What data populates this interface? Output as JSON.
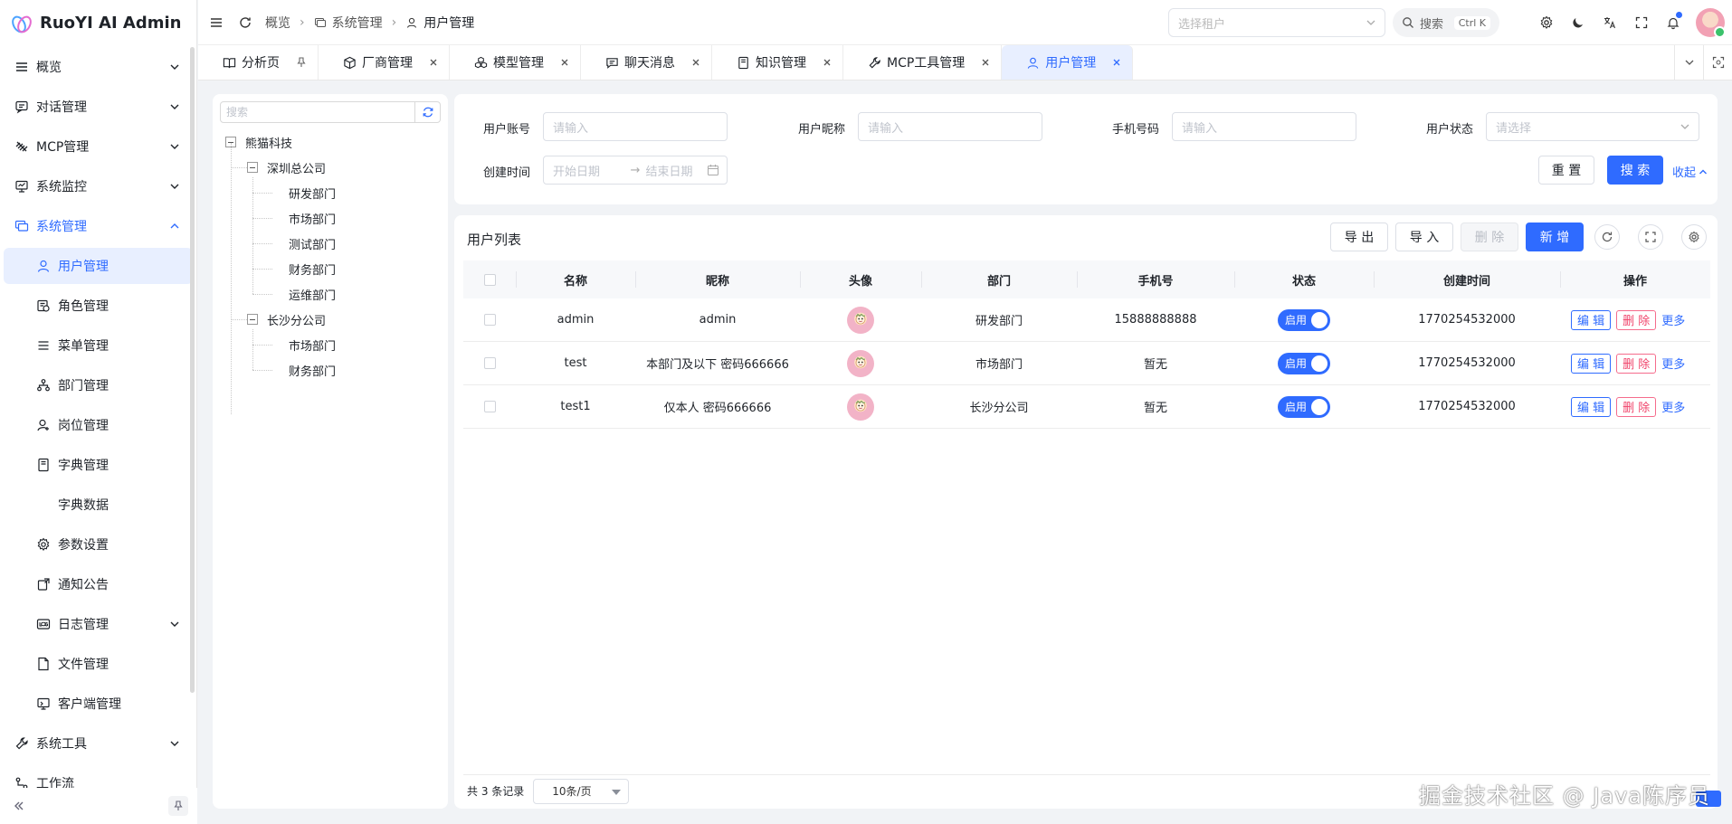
{
  "brand": {
    "title": "RuoYI AI Admin"
  },
  "sidebar": {
    "items": [
      {
        "label": "概览",
        "icon": "list-icon",
        "chevron": true
      },
      {
        "label": "对话管理",
        "icon": "chat-icon",
        "chevron": true
      },
      {
        "label": "MCP管理",
        "icon": "mcp-icon",
        "chevron": true
      },
      {
        "label": "系统监控",
        "icon": "monitor-icon",
        "chevron": true
      },
      {
        "label": "系统管理",
        "icon": "window-icon",
        "chevron": true,
        "expanded": true
      },
      {
        "label": "用户管理",
        "icon": "user-icon",
        "sub": true,
        "active": true
      },
      {
        "label": "角色管理",
        "icon": "role-icon",
        "sub": true
      },
      {
        "label": "菜单管理",
        "icon": "menu-icon",
        "sub": true
      },
      {
        "label": "部门管理",
        "icon": "org-icon",
        "sub": true
      },
      {
        "label": "岗位管理",
        "icon": "post-icon",
        "sub": true
      },
      {
        "label": "字典管理",
        "icon": "book-icon",
        "sub": true
      },
      {
        "label": "字典数据",
        "icon": "",
        "sub": true,
        "noicon": true
      },
      {
        "label": "参数设置",
        "icon": "gear-icon",
        "sub": true
      },
      {
        "label": "通知公告",
        "icon": "notice-icon",
        "sub": true
      },
      {
        "label": "日志管理",
        "icon": "log-icon",
        "sub": true,
        "chevron": true
      },
      {
        "label": "文件管理",
        "icon": "file-icon",
        "sub": true
      },
      {
        "label": "客户端管理",
        "icon": "client-icon",
        "sub": true
      },
      {
        "label": "系统工具",
        "icon": "tool-icon",
        "chevron": true
      },
      {
        "label": "工作流",
        "icon": "flow-icon",
        "chevron": false
      }
    ]
  },
  "header": {
    "breadcrumb": [
      "概览",
      "系统管理",
      "用户管理"
    ],
    "tenant_placeholder": "选择租户",
    "search_label": "搜索",
    "search_shortcut": "Ctrl K"
  },
  "tabs": [
    {
      "label": "分析页",
      "icon": "book-open-icon",
      "close": "pin"
    },
    {
      "label": "厂商管理",
      "icon": "cube-icon",
      "close": "x"
    },
    {
      "label": "模型管理",
      "icon": "cubes-icon",
      "close": "x"
    },
    {
      "label": "聊天消息",
      "icon": "message-icon",
      "close": "x"
    },
    {
      "label": "知识管理",
      "icon": "book-icon",
      "close": "x"
    },
    {
      "label": "MCP工具管理",
      "icon": "tool-icon",
      "close": "x"
    },
    {
      "label": "用户管理",
      "icon": "user-icon",
      "close": "x",
      "active": true
    }
  ],
  "tree": {
    "search_placeholder": "搜索",
    "root": "熊猫科技",
    "branches": [
      {
        "name": "深圳总公司",
        "children": [
          "研发部门",
          "市场部门",
          "测试部门",
          "财务部门",
          "运维部门"
        ]
      },
      {
        "name": "长沙分公司",
        "children": [
          "市场部门",
          "财务部门"
        ]
      }
    ]
  },
  "form": {
    "account_label": "用户账号",
    "account_placeholder": "请输入",
    "nickname_label": "用户昵称",
    "nickname_placeholder": "请输入",
    "phone_label": "手机号码",
    "phone_placeholder": "请输入",
    "status_label": "用户状态",
    "status_placeholder": "请选择",
    "created_label": "创建时间",
    "start_placeholder": "开始日期",
    "end_placeholder": "结束日期",
    "reset_label": "重 置",
    "search_label": "搜 索",
    "collapse_label": "收起"
  },
  "table": {
    "title": "用户列表",
    "export_label": "导 出",
    "import_label": "导 入",
    "delete_label": "删 除",
    "add_label": "新 增",
    "columns": [
      "名称",
      "昵称",
      "头像",
      "部门",
      "手机号",
      "状态",
      "创建时间",
      "操作"
    ],
    "rows": [
      {
        "name": "admin",
        "nickname": "admin",
        "dept": "研发部门",
        "phone": "15888888888",
        "status": "启用",
        "created": "1770254532000"
      },
      {
        "name": "test",
        "nickname": "本部门及以下 密码666666",
        "dept": "市场部门",
        "phone": "暂无",
        "status": "启用",
        "created": "1770254532000"
      },
      {
        "name": "test1",
        "nickname": "仅本人 密码666666",
        "dept": "长沙分公司",
        "phone": "暂无",
        "status": "启用",
        "created": "1770254532000"
      }
    ],
    "op_edit": "编 辑",
    "op_delete": "删 除",
    "op_more": "更多"
  },
  "pager": {
    "total_text": "共 3 条记录",
    "page_size": "10条/页"
  },
  "watermark": "掘金技术社区 @ Java陈序员",
  "colors": {
    "primary": "#2f6bff",
    "danger": "#f0436a",
    "active_bg": "#e8efff"
  }
}
